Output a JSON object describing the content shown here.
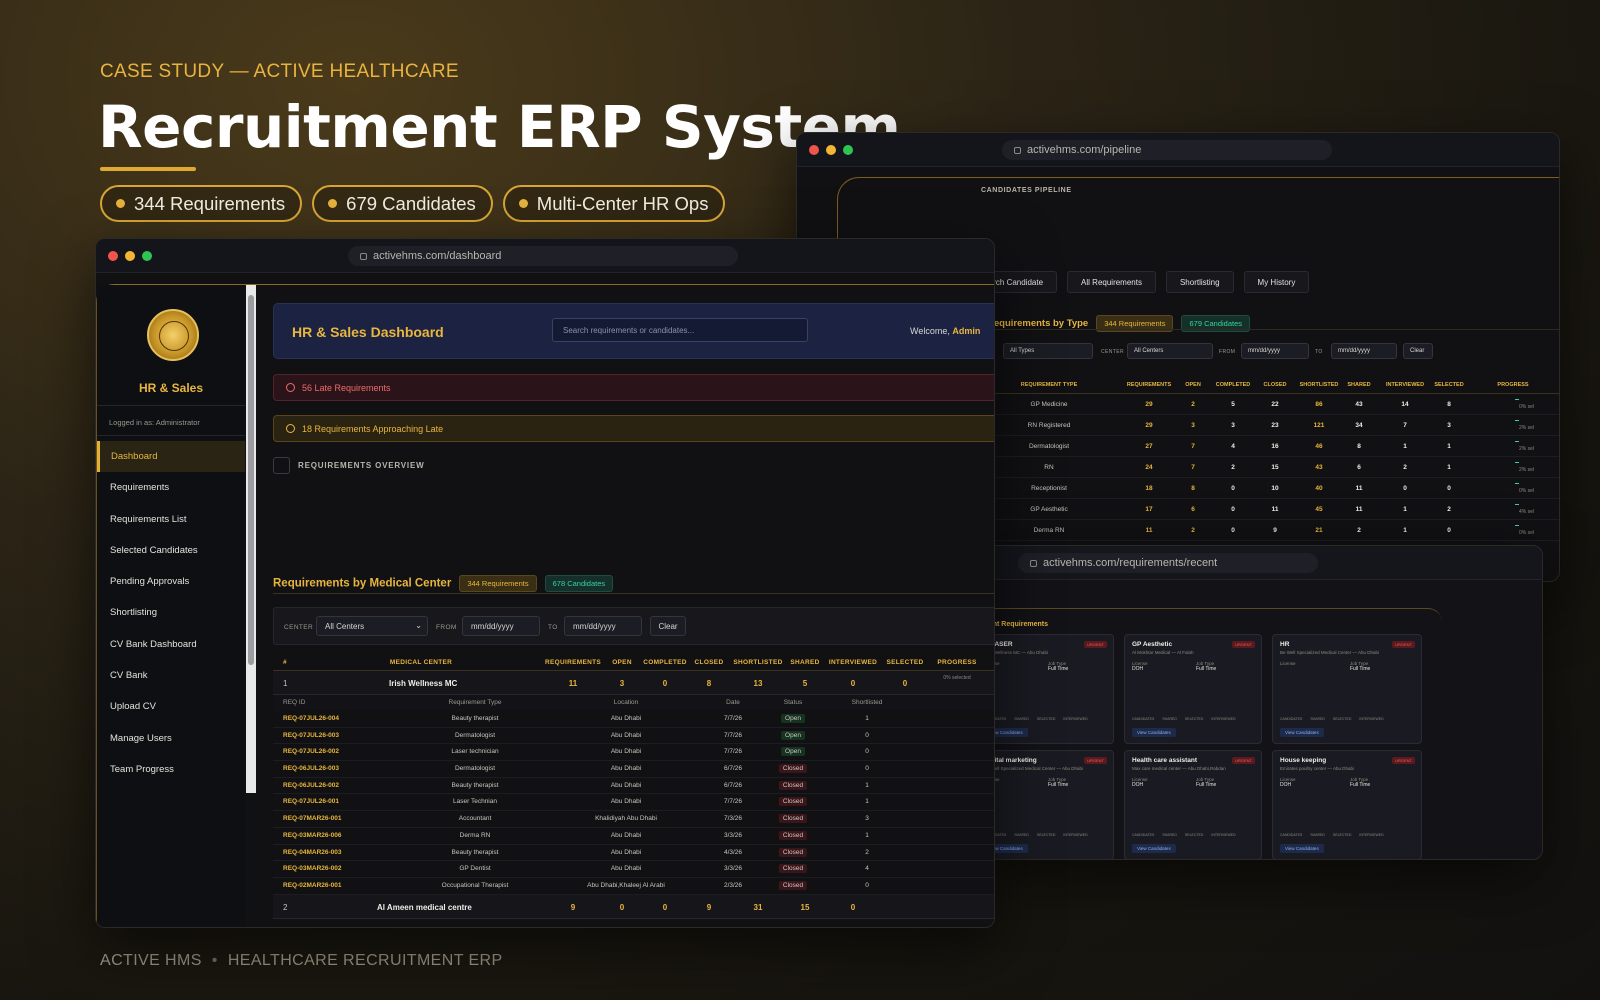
{
  "hero": {
    "eyebrow": "CASE STUDY — ACTIVE HEALTHCARE",
    "title": "Recruitment ERP System",
    "pills": [
      "344 Requirements",
      "679 Candidates",
      "Multi-Center HR Ops"
    ]
  },
  "footer": {
    "brand": "ACTIVE HMS",
    "sep": "•",
    "tagline": "HEALTHCARE RECRUITMENT ERP"
  },
  "colors": {
    "accent": "#e8b63d",
    "open": "#3be07a",
    "closed": "#f06060",
    "teal": "#39d2a4"
  },
  "dashboard": {
    "url": "activehms.com/dashboard",
    "sidebar": {
      "title": "HR & Sales",
      "logged_in": "Logged in as: Administrator",
      "items": [
        "Dashboard",
        "Requirements",
        "Requirements List",
        "Selected Candidates",
        "Pending Approvals",
        "Shortlisting",
        "CV Bank Dashboard",
        "CV Bank",
        "Upload CV",
        "Manage Users",
        "Team Progress"
      ]
    },
    "header": {
      "title": "HR & Sales Dashboard",
      "search_placeholder": "Search requirements or candidates...",
      "welcome": "Welcome, ",
      "user": "Admin"
    },
    "alerts": {
      "late": "56 Late Requirements",
      "approaching": "18 Requirements Approaching Late"
    },
    "overview_title": "REQUIREMENTS OVERVIEW",
    "section": {
      "title": "Requirements by Medical Center",
      "badge_req": "344 Requirements",
      "badge_cand": "678 Candidates"
    },
    "filter": {
      "center_label": "CENTER",
      "center_value": "All Centers",
      "from_label": "FROM",
      "from_value": "mm/dd/yyyy",
      "to_label": "TO",
      "to_value": "mm/dd/yyyy",
      "clear": "Clear"
    },
    "table": {
      "headers": [
        "#",
        "MEDICAL CENTER",
        "REQUIREMENTS",
        "OPEN",
        "COMPLETED",
        "CLOSED",
        "SHORTLISTED",
        "SHARED",
        "INTERVIEWED",
        "SELECTED",
        "PROGRESS"
      ],
      "group1": {
        "num": "1",
        "name": "Irish Wellness MC",
        "values": [
          "11",
          "3",
          "0",
          "8",
          "13",
          "5",
          "0",
          "0"
        ],
        "progress": "0% selected"
      },
      "sub_headers": [
        "REQ ID",
        "Requirement Type",
        "Location",
        "Date",
        "Status",
        "Shortlisted"
      ],
      "rows": [
        [
          "REQ-07JUL26-004",
          "Beauty therapist",
          "Abu Dhabi",
          "7/7/26",
          "Open",
          "1"
        ],
        [
          "REQ-07JUL26-003",
          "Dermatologist",
          "Abu Dhabi",
          "7/7/26",
          "Open",
          "0"
        ],
        [
          "REQ-07JUL26-002",
          "Laser technician",
          "Abu Dhabi",
          "7/7/26",
          "Open",
          "0"
        ],
        [
          "REQ-06JUL26-003",
          "Dermatologist",
          "Abu Dhabi",
          "6/7/26",
          "Closed",
          "0"
        ],
        [
          "REQ-06JUL26-002",
          "Beauty therapist",
          "Abu Dhabi",
          "6/7/26",
          "Closed",
          "1"
        ],
        [
          "REQ-07JUL26-001",
          "Laser Technian",
          "Abu Dhabi",
          "7/7/26",
          "Closed",
          "1"
        ],
        [
          "REQ-07MAR26-001",
          "Accountant",
          "Khalidiyah Abu Dhabi",
          "7/3/26",
          "Closed",
          "3"
        ],
        [
          "REQ-03MAR26-006",
          "Derma RN",
          "Abu Dhabi",
          "3/3/26",
          "Closed",
          "1"
        ],
        [
          "REQ-04MAR26-003",
          "Beauty therapist",
          "Abu Dhabi",
          "4/3/26",
          "Closed",
          "2"
        ],
        [
          "REQ-03MAR26-002",
          "GP Dentist",
          "Abu Dhabi",
          "3/3/26",
          "Closed",
          "4"
        ],
        [
          "REQ-02MAR26-001",
          "Occupational Therapist",
          "Abu Dhabi,Khaleej Al Arabi",
          "2/3/26",
          "Closed",
          "0"
        ]
      ],
      "group2": {
        "num": "2",
        "name": "Al Ameen medical centre",
        "values": [
          "9",
          "0",
          "0",
          "9",
          "31",
          "15",
          "0"
        ]
      }
    }
  },
  "pipeline": {
    "url": "activehms.com/pipeline",
    "section": "CANDIDATES PIPELINE",
    "tabs": [
      "Search Candidate",
      "All Requirements",
      "Shortlisting",
      "My History"
    ],
    "title": "Requirements by Type",
    "badge_req": "344 Requirements",
    "badge_cand": "679 Candidates",
    "filter": {
      "type_value": "All Types",
      "center_label": "CENTER",
      "center_value": "All Centers",
      "from_label": "FROM",
      "from_value": "mm/dd/yyyy",
      "to_label": "TO",
      "to_value": "mm/dd/yyyy",
      "clear": "Clear"
    },
    "headers": [
      "REQUIREMENT TYPE",
      "REQUIREMENTS",
      "OPEN",
      "COMPLETED",
      "CLOSED",
      "SHORTLISTED",
      "SHARED",
      "INTERVIEWED",
      "SELECTED",
      "PROGRESS"
    ],
    "rows": [
      {
        "type": "GP Medicine",
        "v": [
          "29",
          "2",
          "5",
          "22",
          "86",
          "43",
          "14",
          "8"
        ],
        "p": "0% sel"
      },
      {
        "type": "RN Registered",
        "v": [
          "29",
          "3",
          "3",
          "23",
          "121",
          "34",
          "7",
          "3"
        ],
        "p": "2% sel"
      },
      {
        "type": "Dermatologist",
        "v": [
          "27",
          "7",
          "4",
          "16",
          "46",
          "8",
          "1",
          "1"
        ],
        "p": "2% sel"
      },
      {
        "type": "RN",
        "v": [
          "24",
          "7",
          "2",
          "15",
          "43",
          "6",
          "2",
          "1"
        ],
        "p": "2% sel"
      },
      {
        "type": "Receptionist",
        "v": [
          "18",
          "8",
          "0",
          "10",
          "40",
          "11",
          "0",
          "0"
        ],
        "p": "0% sel"
      },
      {
        "type": "GP Aesthetic",
        "v": [
          "17",
          "6",
          "0",
          "11",
          "45",
          "11",
          "1",
          "2"
        ],
        "p": "4% sel"
      },
      {
        "type": "Derma RN",
        "v": [
          "11",
          "2",
          "0",
          "9",
          "21",
          "2",
          "1",
          "0"
        ],
        "p": "0% sel"
      }
    ]
  },
  "recent": {
    "url": "activehms.com/requirements/recent",
    "title": "Recent Requirements",
    "cards": [
      {
        "title": "N LASER",
        "sub": "Irish Wellness MC — Abu Dhabi",
        "k1": "License",
        "v1": "",
        "k2": "Job Type",
        "v2": "Full Time"
      },
      {
        "title": "GP Aesthetic",
        "sub": "Al Mokhtar Medical — Al Falah",
        "k1": "License",
        "v1": "DOH",
        "k2": "Job Type",
        "v2": "Full Time"
      },
      {
        "title": "HR",
        "sub": "Be Well Specialized Medical Center — Abu Dhabi",
        "k1": "License",
        "v1": "",
        "k2": "Job Type",
        "v2": "Full Time"
      },
      {
        "title": "Digital marketing",
        "sub": "Be Well Specialized Medical Center — Abu Dhabi",
        "k1": "License",
        "v1": "",
        "k2": "Job Type",
        "v2": "Full Time"
      },
      {
        "title": "Health care assistant",
        "sub": "Max care medical center — Abu Dhabi,Rabdan",
        "k1": "License",
        "v1": "DOH",
        "k2": "Job Type",
        "v2": "Full Time"
      },
      {
        "title": "House keeping",
        "sub": "Emirates poultry center — Abu Dhabi",
        "k1": "License",
        "v1": "DOH",
        "k2": "Job Type",
        "v2": "Full Time"
      }
    ],
    "urgent_label": "URGENT",
    "view_label": "View Candidates",
    "stat_labels": [
      "CANDIDATES",
      "SHARED",
      "SELECTED",
      "INTERVIEWED"
    ]
  }
}
